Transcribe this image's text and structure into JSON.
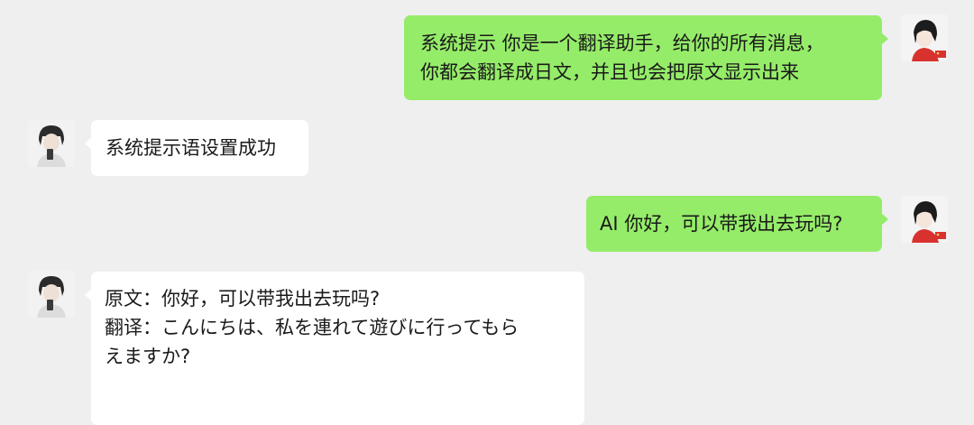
{
  "messages": [
    {
      "sender": "self",
      "lines": [
        "系统提示 你是一个翻译助手，给你的所有消息，",
        "你都会翻译成日文，并且也会把原文显示出来"
      ]
    },
    {
      "sender": "other",
      "lines": [
        "系统提示语设置成功"
      ]
    },
    {
      "sender": "self",
      "lines": [
        "AI 你好，可以带我出去玩吗?"
      ]
    },
    {
      "sender": "other",
      "lines": [
        "原文：你好，可以带我出去玩吗?",
        "翻译：こんにちは、私を連れて遊びに行ってもら",
        "えますか?"
      ]
    }
  ],
  "colors": {
    "self_bubble": "#95ec69",
    "other_bubble": "#ffffff",
    "background": "#efefef"
  }
}
